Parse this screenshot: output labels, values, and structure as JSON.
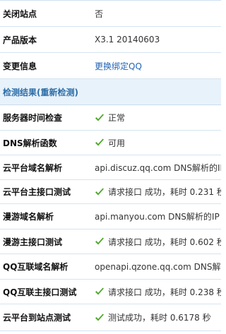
{
  "basic": {
    "close_site_label": "关闭站点",
    "close_site_value": "否",
    "version_label": "产品版本",
    "version_value": "X3.1 20140603",
    "change_label": "变更信息",
    "change_link": "更换绑定QQ"
  },
  "section": {
    "title": "检测结果(重新检测)"
  },
  "checks": [
    {
      "label": "服务器时间检查",
      "ok": true,
      "value": "正常"
    },
    {
      "label": "DNS解析函数",
      "ok": true,
      "value": "可用"
    },
    {
      "label": "云平台域名解析",
      "ok": false,
      "value": "api.discuz.qq.com DNS解析的IP"
    },
    {
      "label": "云平台主接口测试",
      "ok": true,
      "value": "请求接口 成功，耗时 0.231 秒"
    },
    {
      "label": "漫游域名解析",
      "ok": false,
      "value": "api.manyou.com DNS解析的IP"
    },
    {
      "label": "漫游主接口测试",
      "ok": true,
      "value": "请求接口 成功，耗时 0.602 秒"
    },
    {
      "label": "QQ互联域名解析",
      "ok": false,
      "value": "openapi.qzone.qq.com DNS解析"
    },
    {
      "label": "QQ互联主接口测试",
      "ok": true,
      "value": "请求接口 成功，耗时 0.238 秒"
    },
    {
      "label": "云平台到站点测试",
      "ok": true,
      "value": "测试成功，耗时 0.6178 秒"
    }
  ],
  "colors": {
    "check_green": "#4ea82a",
    "link_blue": "#2365b6",
    "section_bg": "#e8f2fb"
  },
  "icons": {
    "check": "check-icon"
  }
}
